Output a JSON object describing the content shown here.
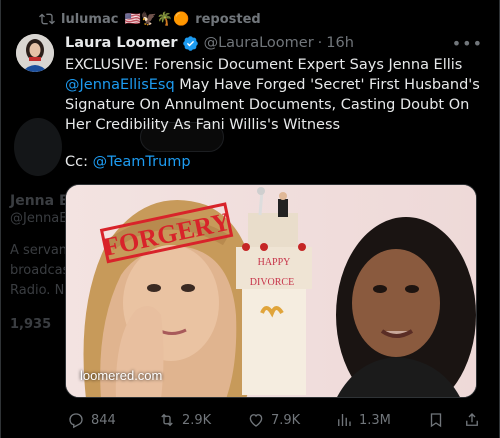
{
  "repost_banner": {
    "user": "lulumac",
    "emoji": "🇺🇸🦅🌴🟠",
    "label": "reposted"
  },
  "author": {
    "name": "Laura Loomer",
    "handle": "@LauraLoomer",
    "time": "16h",
    "verified": true
  },
  "tweet": {
    "text_part1": "EXCLUSIVE: Forensic Document Expert Says Jenna Ellis ",
    "mention1": "@JennaEllisEsq",
    "text_part2": " May Have Forged 'Secret' First Husband's Signature On Annulment Documents, Casting Doubt On Her Credibility As Fani Willis's Witness",
    "cc_label": "Cc: ",
    "mention2": "@TeamTrump"
  },
  "media": {
    "watermark": "loomered.com",
    "stamp": "FORGERY",
    "cake_top": "HAPPY",
    "cake_bottom": "DIVORCE"
  },
  "actions": {
    "replies": "844",
    "reposts": "2.9K",
    "likes": "7.9K",
    "views": "1.3M"
  },
  "background": {
    "name": "Jenna Ellis",
    "handle": "@JennaEllisEsq",
    "bio1": "A servant of Christ",
    "bio2": "broadcast",
    "bio3": "Radio. Not",
    "stat": "1,935"
  },
  "colors": {
    "accent": "#1d9bf0",
    "background": "#000000",
    "muted": "#71767b"
  }
}
